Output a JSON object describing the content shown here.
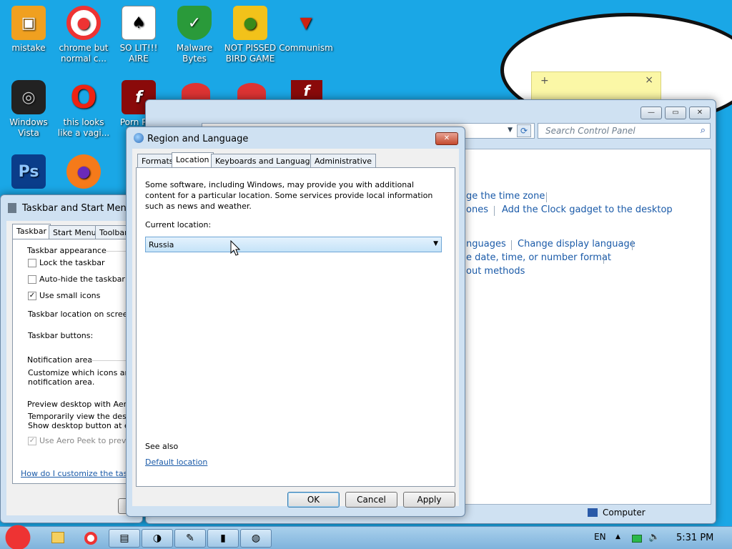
{
  "desktop": {
    "icons": [
      {
        "label": "mistake",
        "icon": "monitor-icon",
        "color": "#f0a020"
      },
      {
        "label": "chrome but normal c...",
        "icon": "chrome-icon",
        "color": "#e33"
      },
      {
        "label": "SO LIT!!! AIRE",
        "icon": "cards-icon",
        "color": "#fff"
      },
      {
        "label": "Malware Bytes",
        "icon": "shield-icon",
        "color": "#2a9a3a"
      },
      {
        "label": "NOT PISSED BIRD GAME",
        "icon": "pig-icon",
        "color": "#f2c21a"
      },
      {
        "label": "Communism",
        "icon": "emblem-icon",
        "color": "#c21"
      },
      {
        "label": "Windows Vista",
        "icon": "trash-icon",
        "color": "#222"
      },
      {
        "label": "this looks like a vagi...",
        "icon": "opera-icon",
        "color": "#e21"
      },
      {
        "label": "Porn Pl...",
        "icon": "flash-icon",
        "color": "#8a0a0a"
      },
      {
        "label": "",
        "icon": "ps-icon",
        "color": "#0a3d8a"
      },
      {
        "label": "",
        "icon": "firefox-icon",
        "color": "#f57a1a"
      }
    ]
  },
  "sticky": {
    "plus": "+",
    "close": "×"
  },
  "control_panel": {
    "search_placeholder": "Search Control Panel",
    "links": {
      "time_zone": "ge the time zone",
      "zones": "ones",
      "clock_gadget": "Add the Clock gadget to the desktop",
      "languages": "nguages",
      "display_language": "Change display language",
      "date_format": "e date, time, or number format",
      "input_methods": "out methods"
    },
    "status": "Computer"
  },
  "taskbar_props": {
    "title": "Taskbar and Start Menu",
    "tabs": [
      "Taskbar",
      "Start Menu",
      "Toolbars"
    ],
    "appearance_label": "Taskbar appearance",
    "lock": "Lock the taskbar",
    "autohide": "Auto-hide the taskbar",
    "small_icons": "Use small icons",
    "location": "Taskbar location on screen:",
    "buttons": "Taskbar buttons:",
    "notif_label": "Notification area",
    "notif_text1": "Customize which icons and n",
    "notif_text2": "notification area.",
    "peek_label": "Preview desktop with Aero P",
    "peek_text1": "Temporarily view the desktop",
    "peek_text2": "Show desktop button at end",
    "peek_cb": "Use Aero Peek to preview",
    "help_link": "How do I customize the taskba"
  },
  "region_dialog": {
    "title": "Region and Language",
    "tabs": [
      "Formats",
      "Location",
      "Keyboards and Languages",
      "Administrative"
    ],
    "description": "Some software, including Windows, may provide you with additional content for a particular location. Some services provide local information such as news and weather.",
    "current_location_label": "Current location:",
    "current_location_value": "Russia",
    "see_also": "See also",
    "default_location_link": "Default location",
    "ok": "OK",
    "cancel": "Cancel",
    "apply": "Apply"
  },
  "taskbar": {
    "lang": "EN",
    "time": "5:31 PM"
  }
}
